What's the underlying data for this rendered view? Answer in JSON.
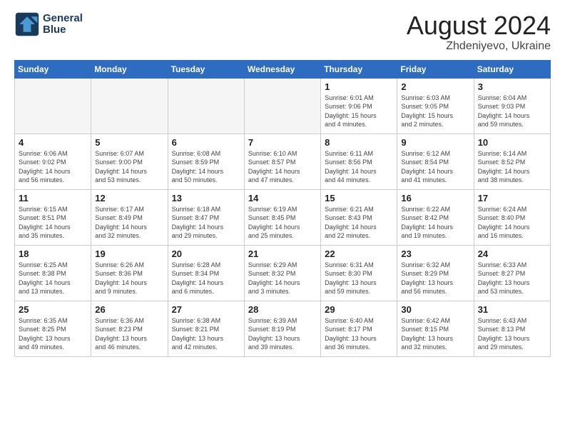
{
  "logo": {
    "line1": "General",
    "line2": "Blue"
  },
  "header": {
    "month_year": "August 2024",
    "location": "Zhdeniyevo, Ukraine"
  },
  "weekdays": [
    "Sunday",
    "Monday",
    "Tuesday",
    "Wednesday",
    "Thursday",
    "Friday",
    "Saturday"
  ],
  "weeks": [
    [
      {
        "day": "",
        "info": ""
      },
      {
        "day": "",
        "info": ""
      },
      {
        "day": "",
        "info": ""
      },
      {
        "day": "",
        "info": ""
      },
      {
        "day": "1",
        "info": "Sunrise: 6:01 AM\nSunset: 9:06 PM\nDaylight: 15 hours\nand 4 minutes."
      },
      {
        "day": "2",
        "info": "Sunrise: 6:03 AM\nSunset: 9:05 PM\nDaylight: 15 hours\nand 2 minutes."
      },
      {
        "day": "3",
        "info": "Sunrise: 6:04 AM\nSunset: 9:03 PM\nDaylight: 14 hours\nand 59 minutes."
      }
    ],
    [
      {
        "day": "4",
        "info": "Sunrise: 6:06 AM\nSunset: 9:02 PM\nDaylight: 14 hours\nand 56 minutes."
      },
      {
        "day": "5",
        "info": "Sunrise: 6:07 AM\nSunset: 9:00 PM\nDaylight: 14 hours\nand 53 minutes."
      },
      {
        "day": "6",
        "info": "Sunrise: 6:08 AM\nSunset: 8:59 PM\nDaylight: 14 hours\nand 50 minutes."
      },
      {
        "day": "7",
        "info": "Sunrise: 6:10 AM\nSunset: 8:57 PM\nDaylight: 14 hours\nand 47 minutes."
      },
      {
        "day": "8",
        "info": "Sunrise: 6:11 AM\nSunset: 8:56 PM\nDaylight: 14 hours\nand 44 minutes."
      },
      {
        "day": "9",
        "info": "Sunrise: 6:12 AM\nSunset: 8:54 PM\nDaylight: 14 hours\nand 41 minutes."
      },
      {
        "day": "10",
        "info": "Sunrise: 6:14 AM\nSunset: 8:52 PM\nDaylight: 14 hours\nand 38 minutes."
      }
    ],
    [
      {
        "day": "11",
        "info": "Sunrise: 6:15 AM\nSunset: 8:51 PM\nDaylight: 14 hours\nand 35 minutes."
      },
      {
        "day": "12",
        "info": "Sunrise: 6:17 AM\nSunset: 8:49 PM\nDaylight: 14 hours\nand 32 minutes."
      },
      {
        "day": "13",
        "info": "Sunrise: 6:18 AM\nSunset: 8:47 PM\nDaylight: 14 hours\nand 29 minutes."
      },
      {
        "day": "14",
        "info": "Sunrise: 6:19 AM\nSunset: 8:45 PM\nDaylight: 14 hours\nand 25 minutes."
      },
      {
        "day": "15",
        "info": "Sunrise: 6:21 AM\nSunset: 8:43 PM\nDaylight: 14 hours\nand 22 minutes."
      },
      {
        "day": "16",
        "info": "Sunrise: 6:22 AM\nSunset: 8:42 PM\nDaylight: 14 hours\nand 19 minutes."
      },
      {
        "day": "17",
        "info": "Sunrise: 6:24 AM\nSunset: 8:40 PM\nDaylight: 14 hours\nand 16 minutes."
      }
    ],
    [
      {
        "day": "18",
        "info": "Sunrise: 6:25 AM\nSunset: 8:38 PM\nDaylight: 14 hours\nand 13 minutes."
      },
      {
        "day": "19",
        "info": "Sunrise: 6:26 AM\nSunset: 8:36 PM\nDaylight: 14 hours\nand 9 minutes."
      },
      {
        "day": "20",
        "info": "Sunrise: 6:28 AM\nSunset: 8:34 PM\nDaylight: 14 hours\nand 6 minutes."
      },
      {
        "day": "21",
        "info": "Sunrise: 6:29 AM\nSunset: 8:32 PM\nDaylight: 14 hours\nand 3 minutes."
      },
      {
        "day": "22",
        "info": "Sunrise: 6:31 AM\nSunset: 8:30 PM\nDaylight: 13 hours\nand 59 minutes."
      },
      {
        "day": "23",
        "info": "Sunrise: 6:32 AM\nSunset: 8:29 PM\nDaylight: 13 hours\nand 56 minutes."
      },
      {
        "day": "24",
        "info": "Sunrise: 6:33 AM\nSunset: 8:27 PM\nDaylight: 13 hours\nand 53 minutes."
      }
    ],
    [
      {
        "day": "25",
        "info": "Sunrise: 6:35 AM\nSunset: 8:25 PM\nDaylight: 13 hours\nand 49 minutes."
      },
      {
        "day": "26",
        "info": "Sunrise: 6:36 AM\nSunset: 8:23 PM\nDaylight: 13 hours\nand 46 minutes."
      },
      {
        "day": "27",
        "info": "Sunrise: 6:38 AM\nSunset: 8:21 PM\nDaylight: 13 hours\nand 42 minutes."
      },
      {
        "day": "28",
        "info": "Sunrise: 6:39 AM\nSunset: 8:19 PM\nDaylight: 13 hours\nand 39 minutes."
      },
      {
        "day": "29",
        "info": "Sunrise: 6:40 AM\nSunset: 8:17 PM\nDaylight: 13 hours\nand 36 minutes."
      },
      {
        "day": "30",
        "info": "Sunrise: 6:42 AM\nSunset: 8:15 PM\nDaylight: 13 hours\nand 32 minutes."
      },
      {
        "day": "31",
        "info": "Sunrise: 6:43 AM\nSunset: 8:13 PM\nDaylight: 13 hours\nand 29 minutes."
      }
    ]
  ]
}
